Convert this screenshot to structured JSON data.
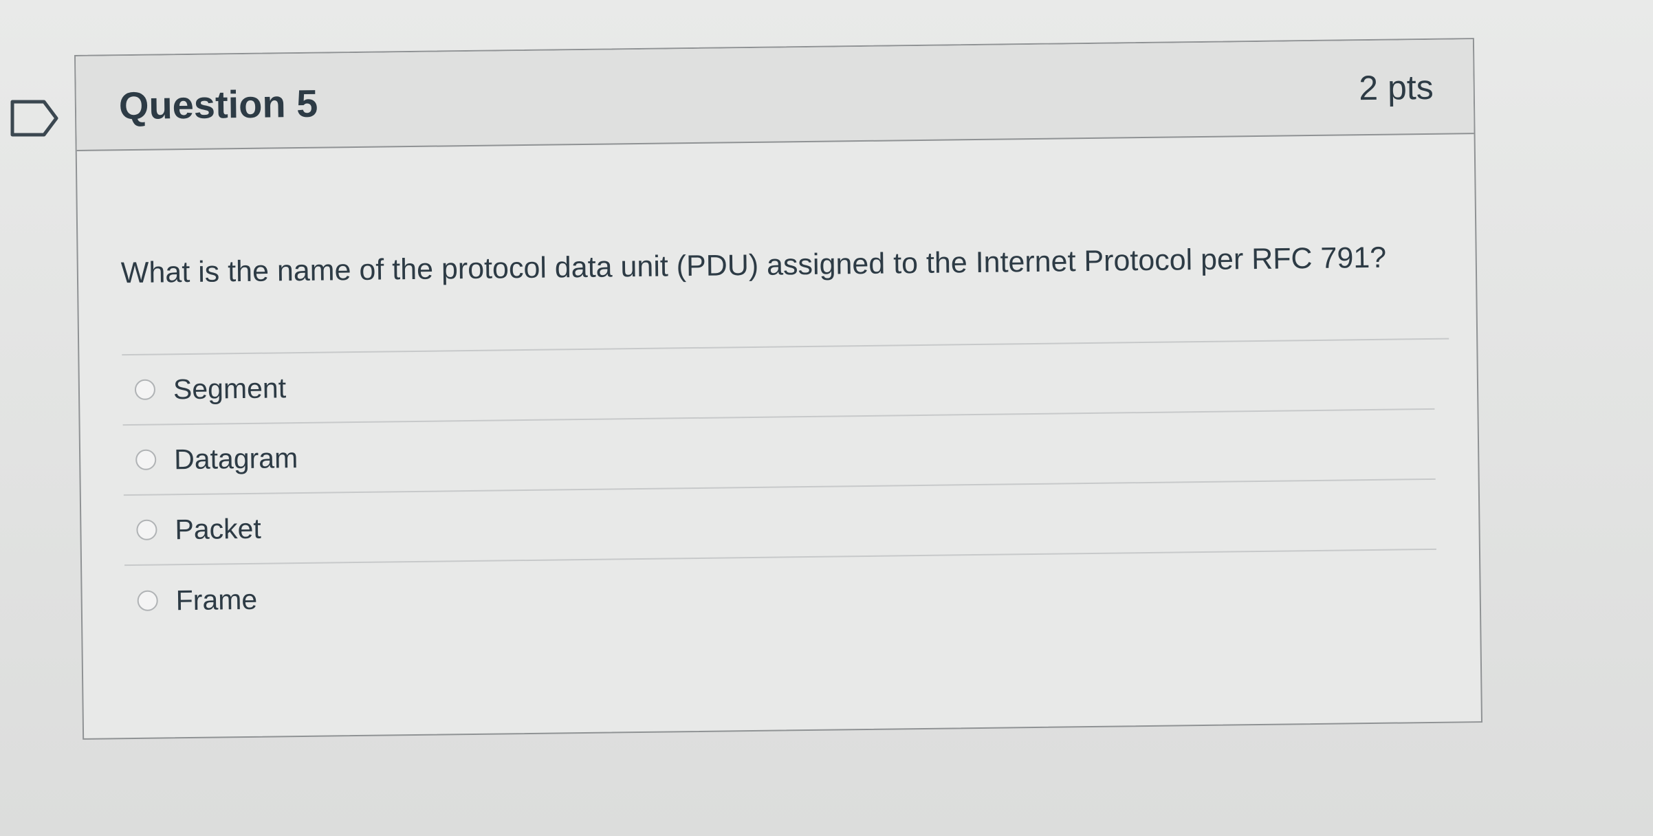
{
  "question": {
    "title": "Question 5",
    "points": "2 pts",
    "text": "What is the name of the protocol data unit (PDU) assigned to the Internet Protocol per RFC 791?",
    "options": [
      {
        "label": "Segment"
      },
      {
        "label": "Datagram"
      },
      {
        "label": "Packet"
      },
      {
        "label": "Frame"
      }
    ]
  },
  "icons": {
    "flag": "flag-icon",
    "radio": "radio-button"
  },
  "colors": {
    "text": "#2d3b45",
    "header_background": "#dfe0df",
    "border": "#8f9294"
  }
}
